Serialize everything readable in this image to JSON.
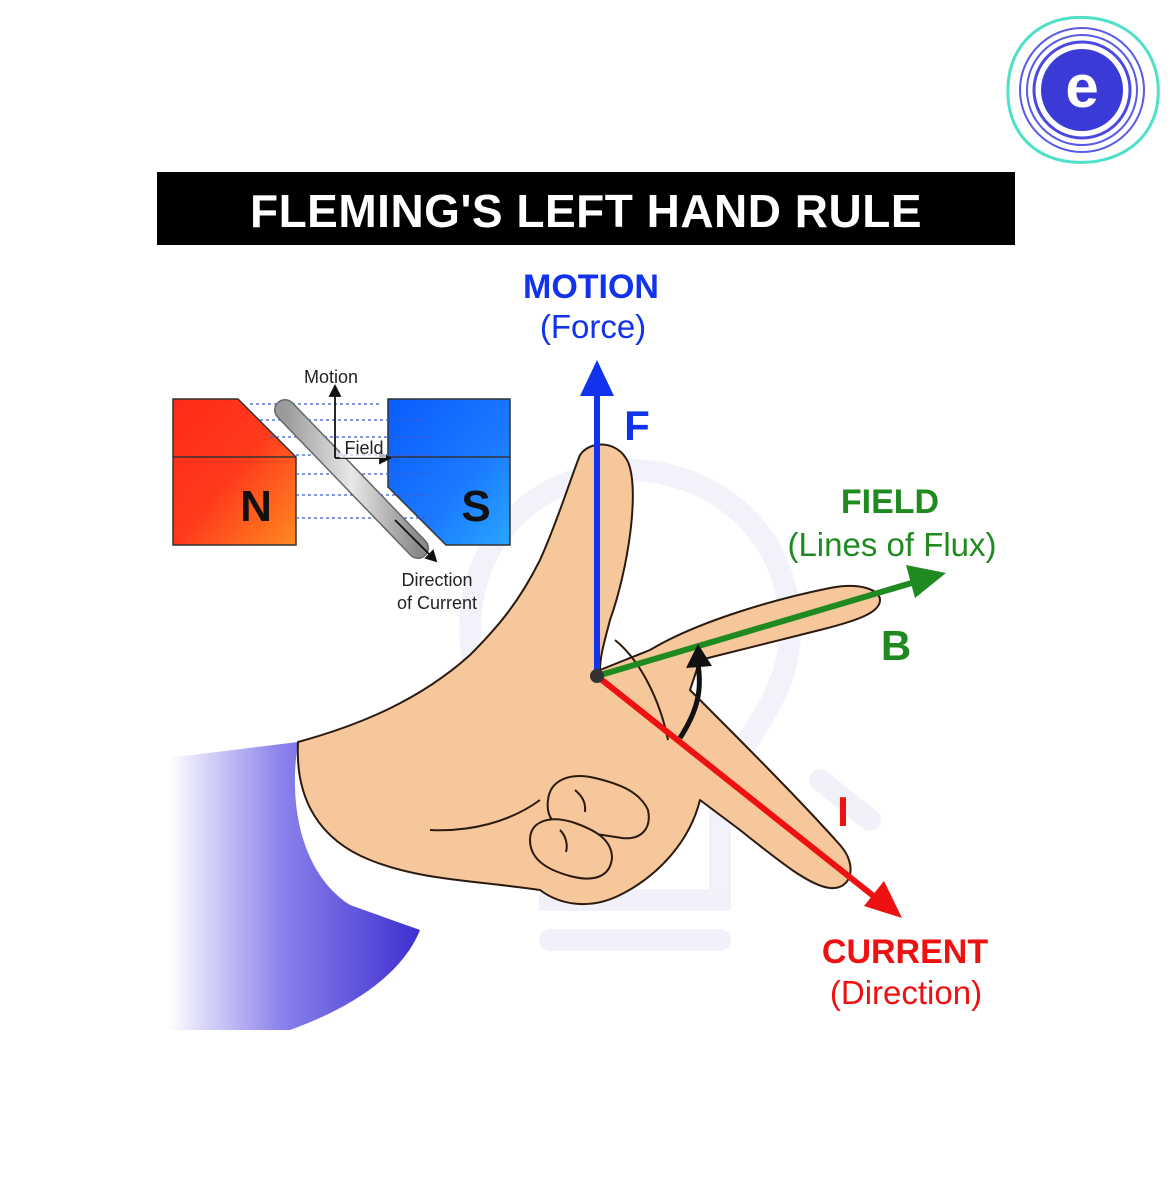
{
  "title": "FLEMING'S LEFT HAND RULE",
  "logo": {
    "letter": "e",
    "ring_color": "#4fe0c8",
    "core_color": "#3a3bd6"
  },
  "motion": {
    "label": "MOTION",
    "sub": "(Force)",
    "symbol": "F",
    "color": "#1133ee"
  },
  "field": {
    "label": "FIELD",
    "sub": "(Lines of Flux)",
    "symbol": "B",
    "color": "#1f8a1f"
  },
  "current": {
    "label": "CURRENT",
    "sub": "(Direction)",
    "symbol": "I",
    "color": "#ee1111"
  },
  "inset": {
    "motion_label": "Motion",
    "field_label": "Field",
    "current_label_line1": "Direction",
    "current_label_line2": "of Current",
    "north": "N",
    "south": "S"
  },
  "colors": {
    "skin": "#f6c79b",
    "sleeve": "#3d2fd0",
    "banner": "#000000"
  }
}
